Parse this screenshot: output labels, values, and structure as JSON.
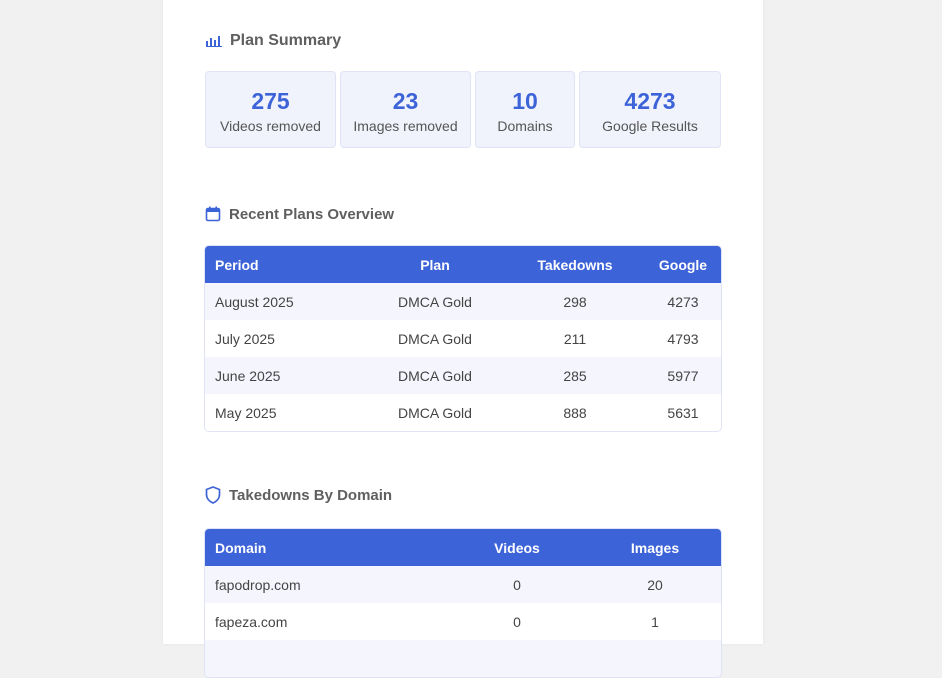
{
  "summary": {
    "title": "Plan Summary",
    "stats": [
      {
        "value": "275",
        "label": "Videos removed"
      },
      {
        "value": "23",
        "label": "Images removed"
      },
      {
        "value": "10",
        "label": "Domains"
      },
      {
        "value": "4273",
        "label": "Google Results"
      }
    ]
  },
  "recent": {
    "title": "Recent Plans Overview",
    "headers": [
      "Period",
      "Plan",
      "Takedowns",
      "Google"
    ],
    "rows": [
      [
        "August 2025",
        "DMCA Gold",
        "298",
        "4273"
      ],
      [
        "July 2025",
        "DMCA Gold",
        "211",
        "4793"
      ],
      [
        "June 2025",
        "DMCA Gold",
        "285",
        "5977"
      ],
      [
        "May 2025",
        "DMCA Gold",
        "888",
        "5631"
      ]
    ]
  },
  "domains": {
    "title": "Takedowns By Domain",
    "headers": [
      "Domain",
      "Videos",
      "Images"
    ],
    "rows": [
      [
        "fapodrop.com",
        "0",
        "20"
      ],
      [
        "fapeza.com",
        "0",
        "1"
      ]
    ]
  },
  "colors": {
    "accent": "#3d63d8",
    "heading": "#5f5f5f",
    "stat_bg": "#f1f3fc",
    "row_alt": "#f5f6fd"
  }
}
